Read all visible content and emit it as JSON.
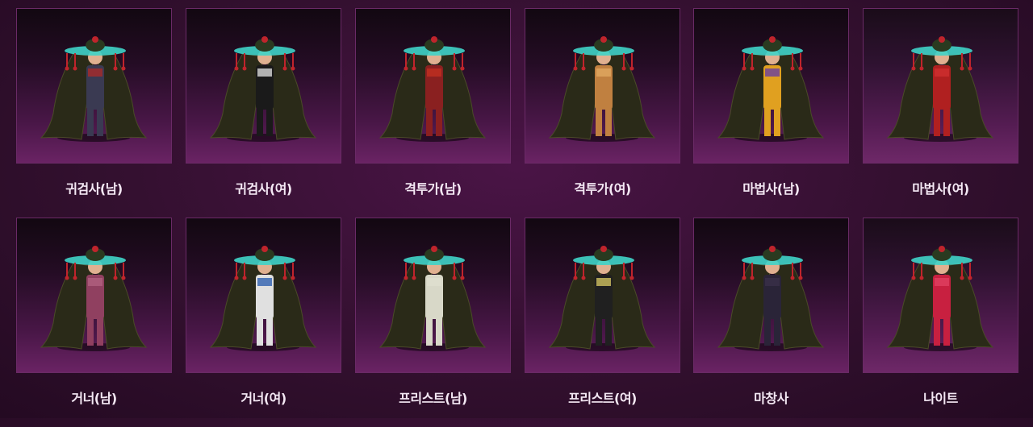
{
  "colors": {
    "background": "#33102f",
    "card_border": "#6a2a66",
    "label": "#f4e8f4",
    "hat_brim": "#3fd4c8",
    "tassel": "#c0242c",
    "cloak": "#2a2a18"
  },
  "costume_grid": {
    "rows": [
      {
        "items": [
          {
            "label": "귀검사(남)",
            "accent": "#a82a2a",
            "outfit": "#3a3a52"
          },
          {
            "label": "귀검사(여)",
            "accent": "#d8d8d8",
            "outfit": "#1a1a1a"
          },
          {
            "label": "격투가(남)",
            "accent": "#c03020",
            "outfit": "#8a2020"
          },
          {
            "label": "격투가(여)",
            "accent": "#e0a860",
            "outfit": "#c08040"
          },
          {
            "label": "마법사(남)",
            "accent": "#6a40a0",
            "outfit": "#e0a020"
          },
          {
            "label": "마법사(여)",
            "accent": "#d03030",
            "outfit": "#b02020"
          }
        ]
      },
      {
        "items": [
          {
            "label": "거너(남)",
            "accent": "#b06080",
            "outfit": "#904060"
          },
          {
            "label": "거너(여)",
            "accent": "#3060b0",
            "outfit": "#e0e0e0"
          },
          {
            "label": "프리스트(남)",
            "accent": "#e0e0d0",
            "outfit": "#d8d8c8"
          },
          {
            "label": "프리스트(여)",
            "accent": "#d0c060",
            "outfit": "#202020"
          },
          {
            "label": "마창사",
            "accent": "#3a3048",
            "outfit": "#2a2438"
          },
          {
            "label": "나이트",
            "accent": "#e04060",
            "outfit": "#c82040"
          }
        ]
      }
    ]
  }
}
